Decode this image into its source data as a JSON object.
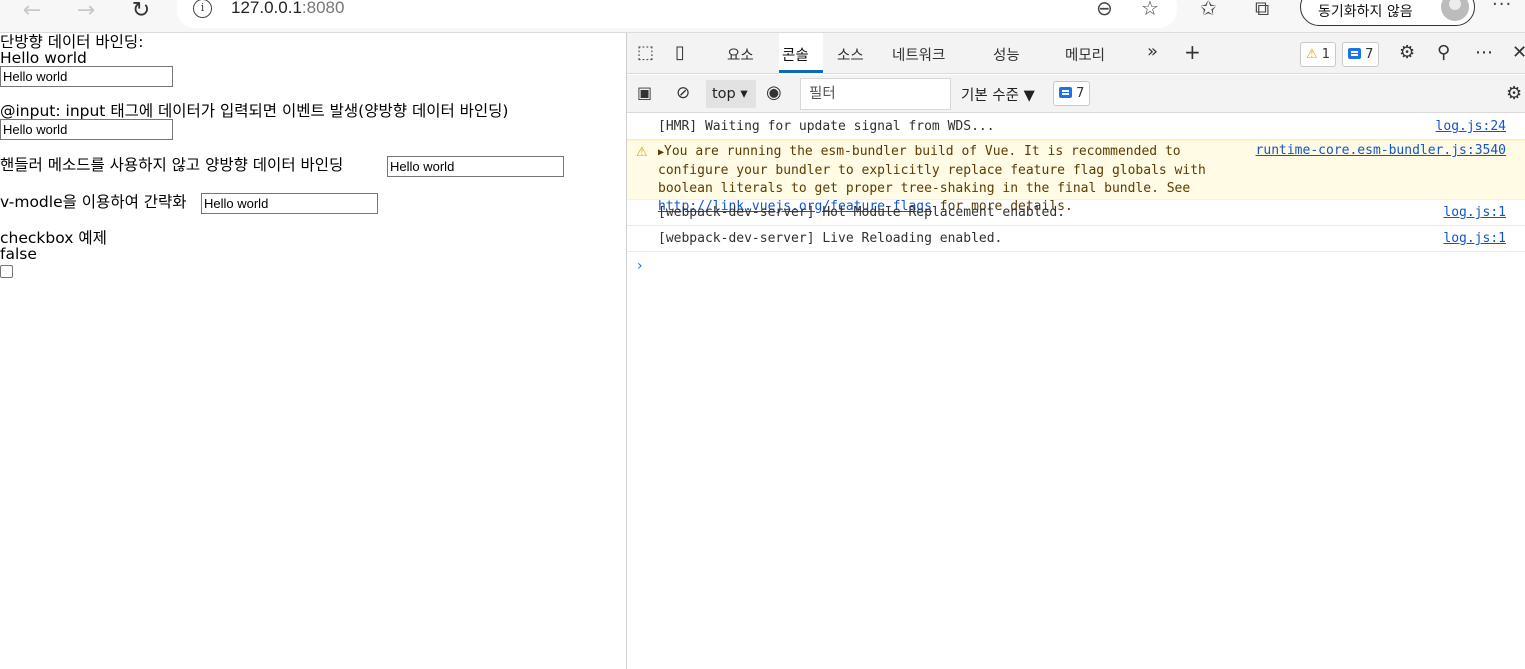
{
  "browser": {
    "back_icon": "back-arrow-icon",
    "forward_icon": "forward-arrow-icon",
    "reload_icon": "reload-icon",
    "url_host": "127.0.0.1",
    "url_port": ":8080",
    "sync_label": "동기화하지 않음"
  },
  "page": {
    "one_way_label": "단방향 데이터 바인딩:",
    "one_way_value": "Hello world",
    "input1_value": "Hello world",
    "input_event_label": "@input: input 태그에 데이터가 입력되면 이벤트 발생(양방향 데이터 바인딩)",
    "input2_value": "Hello world",
    "handler_label": "핸들러 메소드를 사용하지 않고 양방향 데이터 바인딩",
    "input3_value": "Hello world",
    "vmodel_label": "v-modle을 이용하여 간략화",
    "input4_value": "Hello world",
    "checkbox_label": "checkbox 예제",
    "checkbox_value": "false"
  },
  "devtools": {
    "tabs": [
      "요소",
      "콘솔",
      "소스",
      "네트워크",
      "성능",
      "메모리"
    ],
    "active_tab": "콘솔",
    "more_tabs": "»",
    "add_tab": "+",
    "warning_count": "1",
    "message_count": "7",
    "context": "top",
    "filter_placeholder": "필터",
    "level_label": "기본 수준 ▼",
    "toolbar_message_count": "7",
    "console": [
      {
        "type": "log",
        "text": "[HMR] Waiting for update signal from WDS...",
        "source": "log.js:24"
      },
      {
        "type": "warning",
        "text_prefix": "You are running the esm-bundler build of Vue. It is recommended to configure your bundler to explicitly replace feature flag globals with boolean literals to get proper tree-shaking in the final bundle. See ",
        "link": "http://link.vuejs.org/feature-flags",
        "text_suffix": " for more details.",
        "source": "runtime-core.esm-bundler.js:3540"
      },
      {
        "type": "log",
        "text": "[webpack-dev-server] Hot Module Replacement enabled.",
        "source": "log.js:1"
      },
      {
        "type": "log",
        "text": "[webpack-dev-server] Live Reloading enabled.",
        "source": "log.js:1"
      }
    ],
    "prompt": "›"
  },
  "colors": {
    "accent": "#0a68c2",
    "warning_bg": "#fffbe5",
    "link": "#1155cc"
  }
}
